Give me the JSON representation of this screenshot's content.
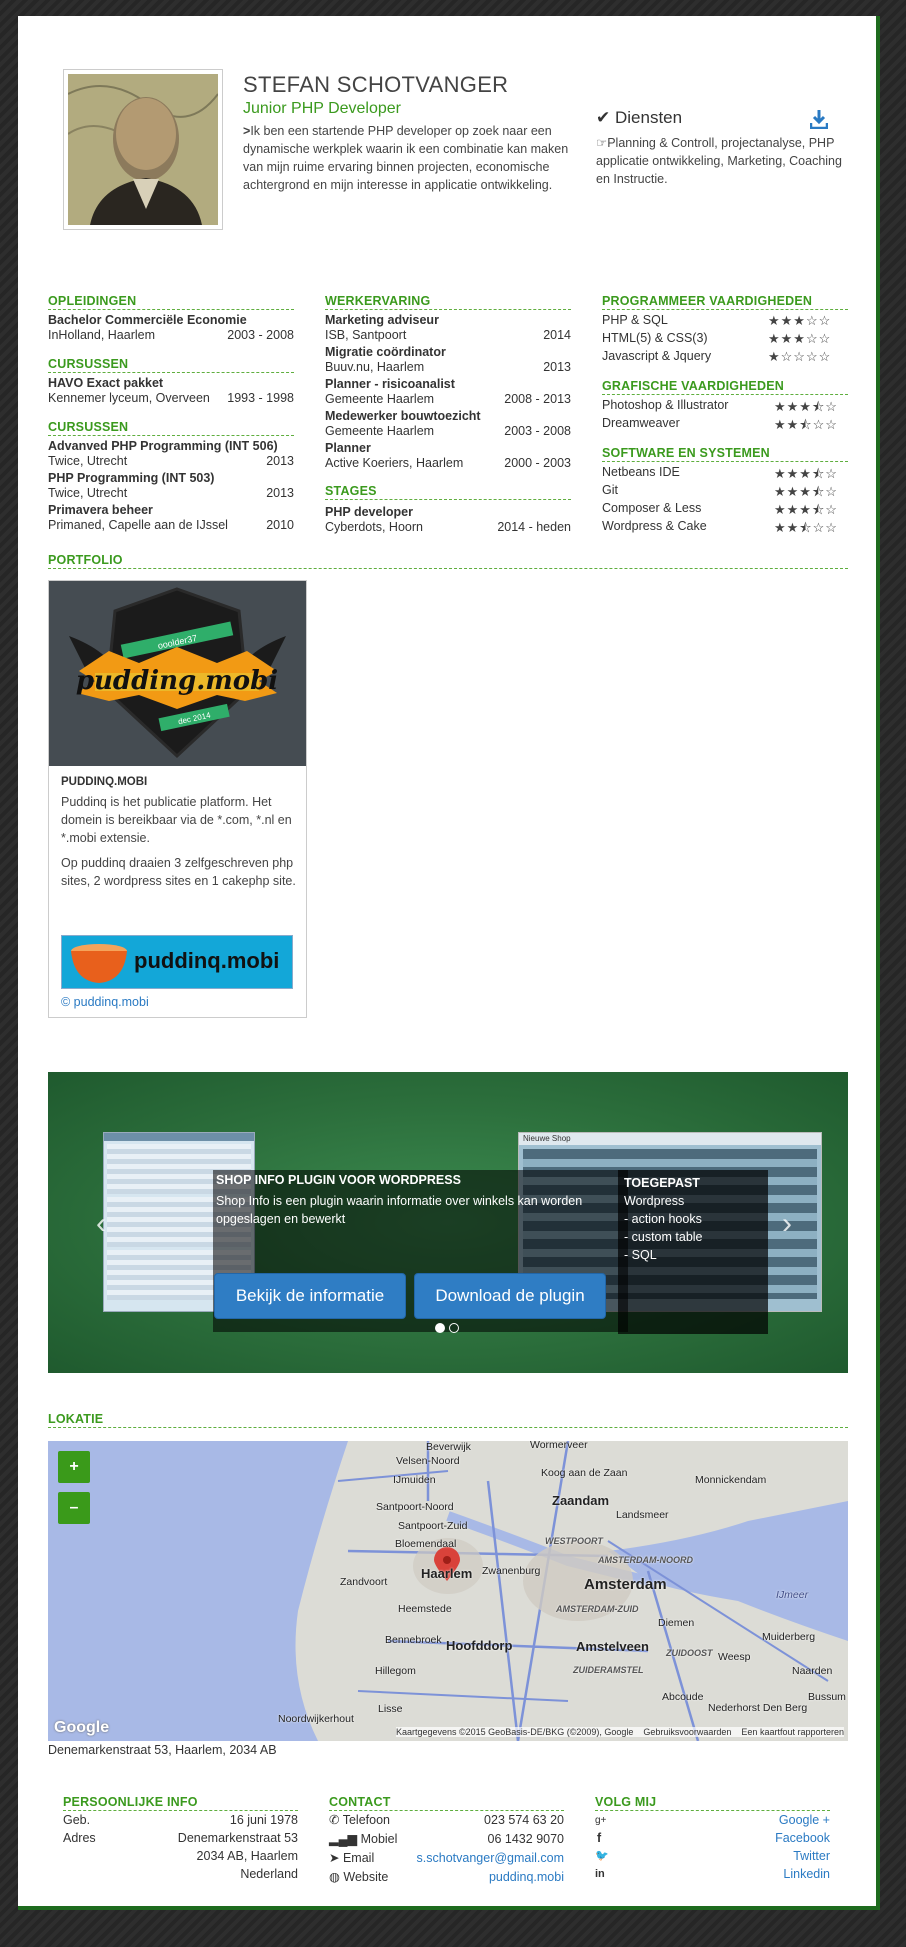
{
  "profile": {
    "name": "STEFAN SCHOTVANGER",
    "role": "Junior PHP Developer",
    "intro": "Ik ben een startende PHP developer op zoek naar een dynamische werkplek waarin ik een combinatie kan maken van mijn ruime ervaring binnen projecten, economische achtergrond en mijn interesse in applicatie ontwikkeling."
  },
  "services": {
    "title": "Diensten",
    "text": "Planning & Controll, projectanalyse, PHP applicatie ontwikkeling, Marketing, Coaching en Instructie."
  },
  "opleidingen": {
    "title": "OPLEIDINGEN",
    "items": [
      {
        "name": "Bachelor Commerciële Economie",
        "place": "InHolland, Haarlem",
        "date": "2003 - 2008"
      }
    ]
  },
  "cursussen1": {
    "title": "CURSUSSEN",
    "items": [
      {
        "name": "HAVO Exact pakket",
        "place": "Kennemer lyceum, Overveen",
        "date": "1993 - 1998"
      }
    ]
  },
  "cursussen2": {
    "title": "CURSUSSEN",
    "items": [
      {
        "name": "Advanved PHP Programming (INT 506)",
        "place": "Twice, Utrecht",
        "date": "2013"
      },
      {
        "name": "PHP Programming (INT 503)",
        "place": "Twice, Utrecht",
        "date": "2013"
      },
      {
        "name": "Primavera beheer",
        "place": "Primaned, Capelle aan de IJssel",
        "date": "2010"
      }
    ]
  },
  "werkervaring": {
    "title": "WERKERVARING",
    "items": [
      {
        "name": "Marketing adviseur",
        "place": "ISB, Santpoort",
        "date": "2014"
      },
      {
        "name": "Migratie coördinator",
        "place": "Buuv.nu, Haarlem",
        "date": "2013"
      },
      {
        "name": "Planner - risicoanalist",
        "place": "Gemeente Haarlem",
        "date": "2008 - 2013"
      },
      {
        "name": "Medewerker bouwtoezicht",
        "place": "Gemeente Haarlem",
        "date": "2003 - 2008"
      },
      {
        "name": "Planner",
        "place": "Active Koeriers, Haarlem",
        "date": "2000 - 2003"
      }
    ]
  },
  "stages": {
    "title": "STAGES",
    "items": [
      {
        "name": "PHP developer",
        "place": "Cyberdots, Hoorn",
        "date": "2014 - heden"
      }
    ]
  },
  "programmeer": {
    "title": "PROGRAMMEER VAARDIGHEDEN",
    "items": [
      {
        "name": "PHP & SQL",
        "rating": 3
      },
      {
        "name": "HTML(5) & CSS(3)",
        "rating": 3
      },
      {
        "name": "Javascript & Jquery",
        "rating": 1
      }
    ]
  },
  "grafisch": {
    "title": "GRAFISCHE VAARDIGHEDEN",
    "items": [
      {
        "name": "Photoshop & Illustrator",
        "rating": 3.5
      },
      {
        "name": "Dreamweaver",
        "rating": 2.5
      }
    ]
  },
  "software": {
    "title": "SOFTWARE EN SYSTEMEN",
    "items": [
      {
        "name": "Netbeans IDE",
        "rating": 3.5
      },
      {
        "name": "Git",
        "rating": 3.5
      },
      {
        "name": "Composer & Less",
        "rating": 3.5
      },
      {
        "name": "Wordpress & Cake",
        "rating": 2.5
      }
    ]
  },
  "portfolio": {
    "title": "PORTFOLIO",
    "card_title": "PUDDINQ.MOBI",
    "p1": "Puddinq is het publicatie platform. Het domein is bereikbaar via de *.com, *.nl en *.mobi extensie.",
    "p2": "Op puddinq draaien 3 zelfgeschreven php sites, 2 wordpress sites en 1 cakephp site.",
    "logo_text": "pudding.mobi",
    "banner_text": "puddinq.mobi",
    "link": "© puddinq.mobi",
    "ribbon_top": "ooolder37",
    "ribbon_bottom": "dec 2014"
  },
  "slider": {
    "title": "SHOP INFO PLUGIN VOOR WORDPRESS",
    "text": "Shop Info is een plugin waarin informatie over winkels kan worden opgeslagen en bewerkt",
    "side_title": "TOEGEPAST",
    "side_lines": [
      "Wordpress",
      "- action hooks",
      "- custom table",
      "- SQL"
    ],
    "btn1": "Bekijk de informatie",
    "btn2": "Download de plugin",
    "screen_label": "Nieuwe Shop"
  },
  "lokatie": {
    "title": "LOKATIE",
    "address": "Denemarkenstraat 53, Haarlem, 2034 AB",
    "zoom_in": "+",
    "zoom_out": "–",
    "google": "Google",
    "attribution": "Kaartgegevens ©2015 GeoBasis-DE/BKG (©2009), Google    Gebruiksvoorwaarden    Een kaartfout rapporteren",
    "places": [
      "Beverwijk",
      "Wormerveer",
      "Velsen-Noord",
      "IJmuiden",
      "Koog aan de Zaan",
      "Zaandam",
      "Monnickendam",
      "Landsmeer",
      "Santpoort-Noord",
      "Santpoort-Zuid",
      "Bloemendaal",
      "WESTPOORT",
      "Zwanenburg",
      "AMSTERDAM-NOORD",
      "Zandvoort",
      "Haarlem",
      "Amsterdam",
      "IJmeer",
      "Heemstede",
      "AMSTERDAM-ZUID",
      "Diemen",
      "Bennebroek",
      "Hoofddorp",
      "Amstelveen",
      "ZUIDOOST",
      "Weesp",
      "Muiderberg",
      "Hillegom",
      "Naarden",
      "Abcoude",
      "Bussum",
      "Lisse",
      "Noordwijkerhout",
      "Nederhorst Den Berg",
      "ZUIDERAMSTEL"
    ]
  },
  "persoonlijk": {
    "title": "PERSOONLIJKE INFO",
    "geb_label": "Geb.",
    "geb": "16 juni 1978",
    "adres_label": "Adres",
    "adres": [
      "Denemarkenstraat 53",
      "2034 AB, Haarlem",
      "Nederland"
    ]
  },
  "contact": {
    "title": "CONTACT",
    "items": [
      {
        "label": "Telefoon",
        "value": "023 574 63 20"
      },
      {
        "label": "Mobiel",
        "value": "06 1432 9070"
      },
      {
        "label": "Email",
        "value": "s.schotvanger@gmail.com"
      },
      {
        "label": "Website",
        "value": "puddinq.mobi"
      }
    ]
  },
  "volg": {
    "title": "VOLG MIJ",
    "items": [
      {
        "icon": "g+",
        "label": "Google +"
      },
      {
        "icon": "f",
        "label": "Facebook"
      },
      {
        "icon": "twitter",
        "label": "Twitter"
      },
      {
        "icon": "in",
        "label": "Linkedin"
      }
    ]
  },
  "colors": {
    "accent": "#3b9a1e",
    "link": "#2a7ac3",
    "button": "#2f7dc4"
  }
}
